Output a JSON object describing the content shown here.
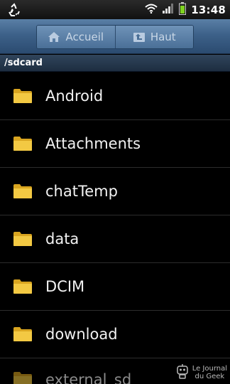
{
  "status_bar": {
    "time": "13:48",
    "icons": [
      "recycle-icon",
      "wifi-icon",
      "signal-icon",
      "battery-icon"
    ]
  },
  "toolbar": {
    "home_label": "Accueil",
    "up_label": "Haut",
    "icons": [
      "home-icon",
      "up-folder-icon"
    ]
  },
  "path": "/sdcard",
  "files": [
    {
      "name": "Android",
      "icon": "folder-icon"
    },
    {
      "name": "Attachments",
      "icon": "folder-icon"
    },
    {
      "name": "chatTemp",
      "icon": "folder-icon"
    },
    {
      "name": "data",
      "icon": "folder-icon"
    },
    {
      "name": "DCIM",
      "icon": "folder-icon"
    },
    {
      "name": "download",
      "icon": "folder-icon"
    },
    {
      "name": "external_sd",
      "icon": "folder-icon"
    }
  ],
  "watermark": {
    "line1": "Le Journal",
    "line2": "du Geek"
  },
  "colors": {
    "toolbar": "#3d6189",
    "folder": "#f0c43a",
    "background": "#000000"
  }
}
